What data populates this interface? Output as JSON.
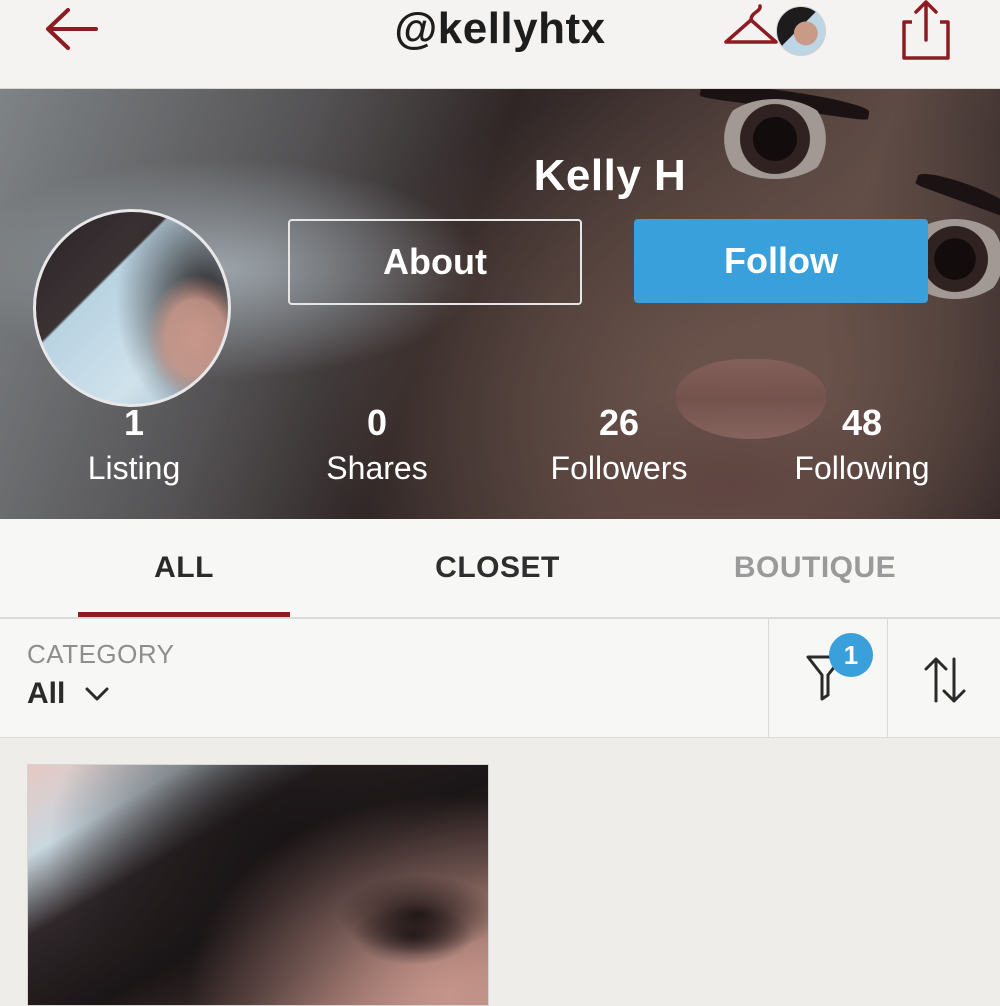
{
  "header": {
    "username": "@kellyhtx",
    "icons": [
      "back-arrow-icon",
      "hanger-icon",
      "share-icon"
    ]
  },
  "profile": {
    "name": "Kelly H",
    "about_label": "About",
    "follow_label": "Follow",
    "stats": [
      {
        "value": "1",
        "label": "Listing"
      },
      {
        "value": "0",
        "label": "Shares"
      },
      {
        "value": "26",
        "label": "Followers"
      },
      {
        "value": "48",
        "label": "Following"
      }
    ]
  },
  "tabs": [
    {
      "label": "ALL",
      "active": true
    },
    {
      "label": "CLOSET",
      "active": false
    },
    {
      "label": "BOUTIQUE",
      "active": false
    }
  ],
  "filters": {
    "category_label": "CATEGORY",
    "category_value": "All",
    "filter_count": "1"
  },
  "colors": {
    "accent": "#8c1c22",
    "follow_blue": "#3aa0db",
    "badge_blue": "#3aa0db"
  }
}
